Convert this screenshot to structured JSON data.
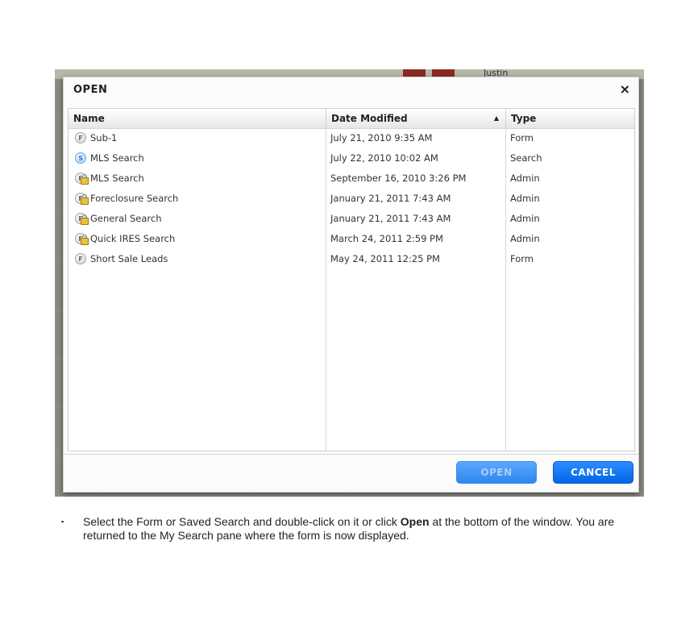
{
  "backdrop": {
    "map_label": "Justin"
  },
  "dialog": {
    "title": "OPEN",
    "close_icon": "×",
    "columns": {
      "name": "Name",
      "date": "Date Modified",
      "type": "Type",
      "sort_indicator": "▲"
    },
    "rows": [
      {
        "icon": "form",
        "icon_letter": "F",
        "name": "Sub-1",
        "date": "July 21, 2010 9:35 AM",
        "type": "Form"
      },
      {
        "icon": "search",
        "icon_letter": "S",
        "name": "MLS Search",
        "date": "July 22, 2010 10:02 AM",
        "type": "Search"
      },
      {
        "icon": "admin",
        "icon_letter": "F",
        "name": "MLS Search",
        "date": "September 16, 2010 3:26 PM",
        "type": "Admin"
      },
      {
        "icon": "admin",
        "icon_letter": "F",
        "name": "Foreclosure Search",
        "date": "January 21, 2011 7:43 AM",
        "type": "Admin"
      },
      {
        "icon": "admin",
        "icon_letter": "F",
        "name": "General Search",
        "date": "January 21, 2011 7:43 AM",
        "type": "Admin"
      },
      {
        "icon": "admin",
        "icon_letter": "F",
        "name": "Quick IRES Search",
        "date": "March 24, 2011 2:59 PM",
        "type": "Admin"
      },
      {
        "icon": "form",
        "icon_letter": "F",
        "name": "Short Sale Leads",
        "date": "May 24, 2011 12:25 PM",
        "type": "Form"
      }
    ],
    "buttons": {
      "open": "OPEN",
      "cancel": "CANCEL"
    }
  },
  "caption": {
    "bullet": "▪",
    "part1": "Select the Form or Saved Search and double-click on it or click ",
    "bold": "Open",
    "part2": " at the bottom of the window. You are returned to the My Search pane where the form is now displayed."
  }
}
